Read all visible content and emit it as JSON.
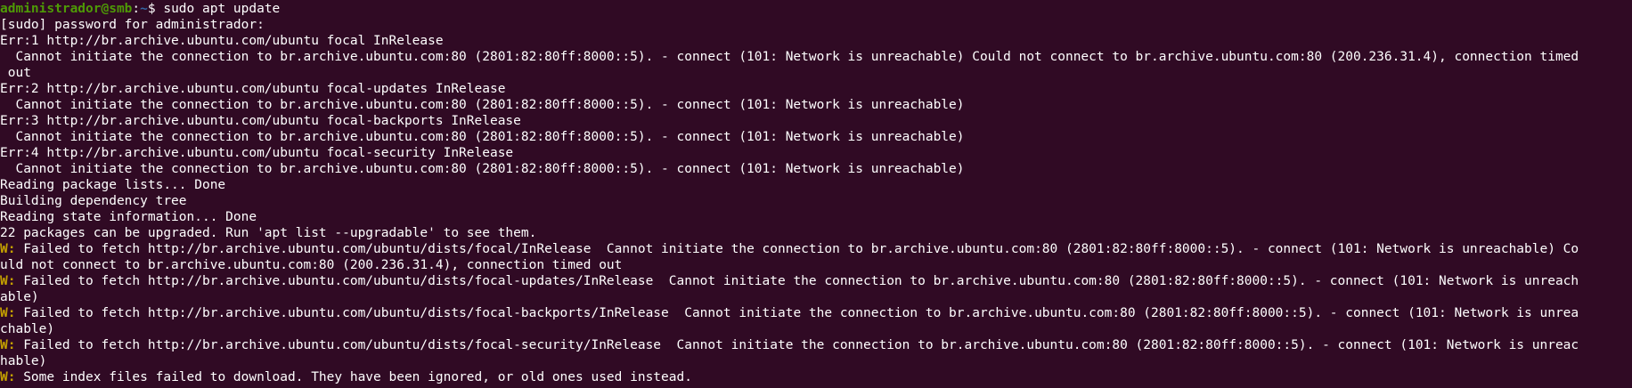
{
  "prompt": {
    "user_host": "administrador@smb",
    "colon": ":",
    "path": "~",
    "dollar": "$ ",
    "command": "sudo apt update"
  },
  "colors": {
    "background": "#300a24",
    "text": "#ffffff",
    "user_host": "#4e9a06",
    "path": "#3465a4",
    "warning_prefix": "#c4a000"
  },
  "lines": [
    {
      "text": "[sudo] password for administrador:"
    },
    {
      "text": "Err:1 http://br.archive.ubuntu.com/ubuntu focal InRelease"
    },
    {
      "text": "  Cannot initiate the connection to br.archive.ubuntu.com:80 (2801:82:80ff:8000::5). - connect (101: Network is unreachable) Could not connect to br.archive.ubuntu.com:80 (200.236.31.4), connection timed"
    },
    {
      "text": " out"
    },
    {
      "text": "Err:2 http://br.archive.ubuntu.com/ubuntu focal-updates InRelease"
    },
    {
      "text": "  Cannot initiate the connection to br.archive.ubuntu.com:80 (2801:82:80ff:8000::5). - connect (101: Network is unreachable)"
    },
    {
      "text": "Err:3 http://br.archive.ubuntu.com/ubuntu focal-backports InRelease"
    },
    {
      "text": "  Cannot initiate the connection to br.archive.ubuntu.com:80 (2801:82:80ff:8000::5). - connect (101: Network is unreachable)"
    },
    {
      "text": "Err:4 http://br.archive.ubuntu.com/ubuntu focal-security InRelease"
    },
    {
      "text": "  Cannot initiate the connection to br.archive.ubuntu.com:80 (2801:82:80ff:8000::5). - connect (101: Network is unreachable)"
    },
    {
      "text": "Reading package lists... Done"
    },
    {
      "text": "Building dependency tree"
    },
    {
      "text": "Reading state information... Done"
    },
    {
      "text": "22 packages can be upgraded. Run 'apt list --upgradable' to see them."
    },
    {
      "prefix": "W:",
      "text": " Failed to fetch http://br.archive.ubuntu.com/ubuntu/dists/focal/InRelease  Cannot initiate the connection to br.archive.ubuntu.com:80 (2801:82:80ff:8000::5). - connect (101: Network is unreachable) Co"
    },
    {
      "text": "uld not connect to br.archive.ubuntu.com:80 (200.236.31.4), connection timed out"
    },
    {
      "prefix": "W:",
      "text": " Failed to fetch http://br.archive.ubuntu.com/ubuntu/dists/focal-updates/InRelease  Cannot initiate the connection to br.archive.ubuntu.com:80 (2801:82:80ff:8000::5). - connect (101: Network is unreach"
    },
    {
      "text": "able)"
    },
    {
      "prefix": "W:",
      "text": " Failed to fetch http://br.archive.ubuntu.com/ubuntu/dists/focal-backports/InRelease  Cannot initiate the connection to br.archive.ubuntu.com:80 (2801:82:80ff:8000::5). - connect (101: Network is unrea"
    },
    {
      "text": "chable)"
    },
    {
      "prefix": "W:",
      "text": " Failed to fetch http://br.archive.ubuntu.com/ubuntu/dists/focal-security/InRelease  Cannot initiate the connection to br.archive.ubuntu.com:80 (2801:82:80ff:8000::5). - connect (101: Network is unreac"
    },
    {
      "text": "hable)"
    },
    {
      "prefix": "W:",
      "text": " Some index files failed to download. They have been ignored, or old ones used instead."
    }
  ]
}
